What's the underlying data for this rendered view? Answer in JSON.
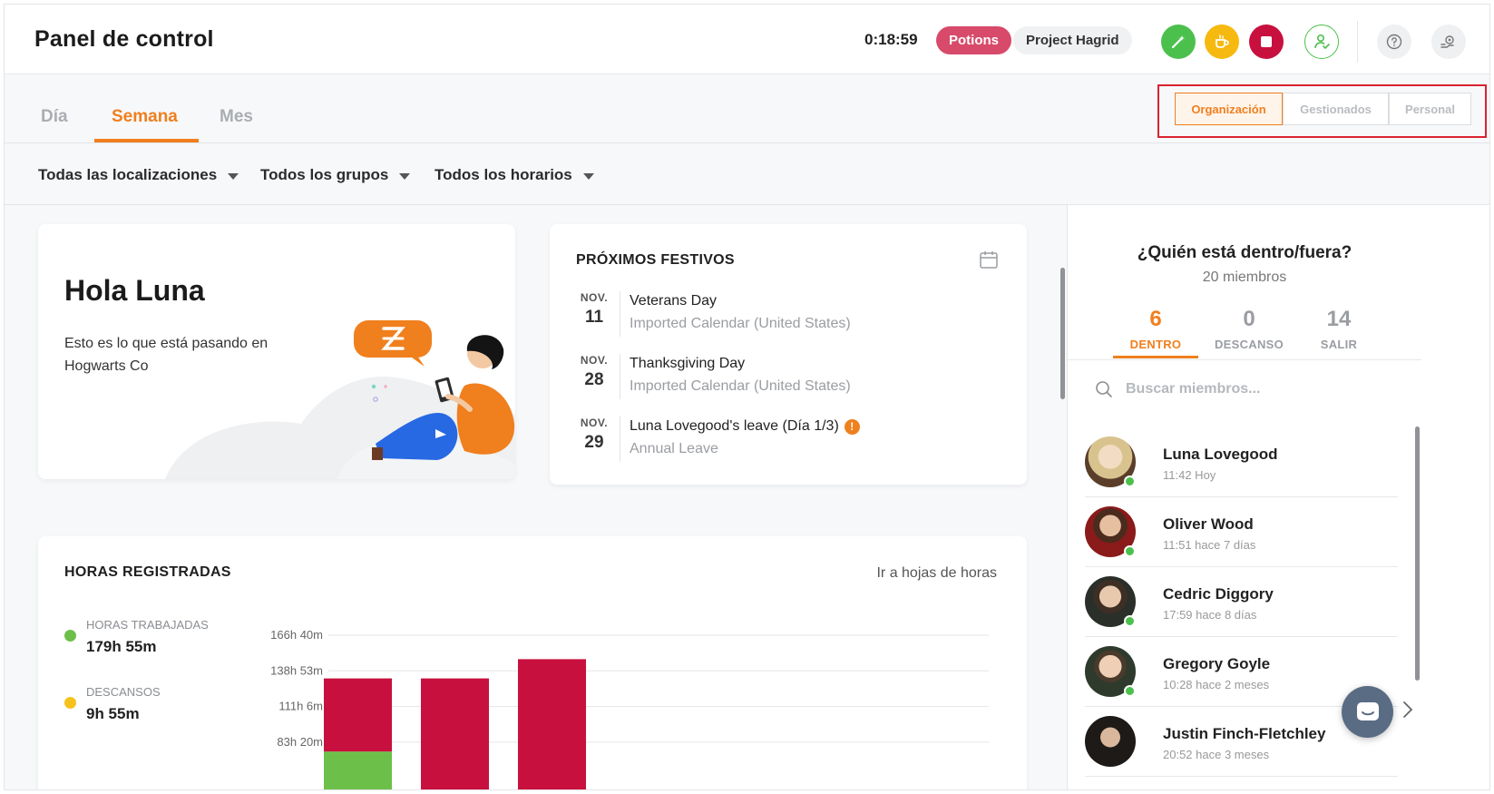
{
  "header": {
    "title": "Panel de control",
    "timer": "0:18:59",
    "activity_tag": "Potions",
    "project_tag": "Project Hagrid",
    "colors": {
      "accent": "#f07f1e",
      "green": "#4cc04c",
      "yellow": "#f6b90f",
      "red": "#c8103e",
      "potions": "#d84a6a"
    },
    "icons": [
      "wand-icon",
      "coffee-icon",
      "stop-icon",
      "user-check-icon",
      "help-icon",
      "settings-icon"
    ]
  },
  "tabs": [
    {
      "label": "Día",
      "active": false
    },
    {
      "label": "Semana",
      "active": true
    },
    {
      "label": "Mes",
      "active": false
    }
  ],
  "scope": [
    {
      "label": "Organización",
      "active": true
    },
    {
      "label": "Gestionados",
      "active": false
    },
    {
      "label": "Personal",
      "active": false
    }
  ],
  "filters": [
    "Todas las localizaciones",
    "Todos los grupos",
    "Todos los horarios"
  ],
  "greeting": {
    "title": "Hola Luna",
    "subtitle": "Esto es lo que está pasando en Hogwarts Co"
  },
  "holidays": {
    "title": "PRÓXIMOS FESTIVOS",
    "items": [
      {
        "month": "NOV.",
        "day": "11",
        "name": "Veterans Day",
        "source": "Imported Calendar (United States)"
      },
      {
        "month": "NOV.",
        "day": "28",
        "name": "Thanksgiving Day",
        "source": "Imported Calendar (United States)"
      },
      {
        "month": "NOV.",
        "day": "29",
        "name": "Luna Lovegood's leave (Día 1/3)",
        "source": "Annual Leave",
        "alert": "!"
      }
    ]
  },
  "hours": {
    "title": "HORAS REGISTRADAS",
    "link": "Ir a hojas de horas",
    "legend": [
      {
        "label": "HORAS TRABAJADAS",
        "value": "179h 55m",
        "color": "#6cc04a"
      },
      {
        "label": "DESCANSOS",
        "value": "9h 55m",
        "color": "#f6c21c"
      }
    ]
  },
  "chart_data": {
    "type": "bar",
    "stacked": true,
    "y_ticks": [
      "166h 40m",
      "138h 53m",
      "111h 6m",
      "83h 20m"
    ],
    "y_tick_values": [
      166.67,
      138.88,
      111.1,
      83.33
    ],
    "bars": [
      {
        "segments": [
          {
            "value": 76,
            "color": "#6cc04a"
          },
          {
            "value": 57,
            "color": "#c8103e"
          }
        ]
      },
      {
        "segments": [
          {
            "value": 133,
            "color": "#c8103e"
          }
        ]
      },
      {
        "segments": [
          {
            "value": 148,
            "color": "#c8103e"
          }
        ]
      }
    ],
    "grid": true
  },
  "who": {
    "title": "¿Quién está dentro/fuera?",
    "subtitle": "20 miembros",
    "stats": [
      {
        "num": "6",
        "label": "DENTRO",
        "active": true
      },
      {
        "num": "0",
        "label": "DESCANSO",
        "active": false
      },
      {
        "num": "14",
        "label": "SALIR",
        "active": false
      }
    ],
    "search_placeholder": "Buscar miembros...",
    "members": [
      {
        "name": "Luna Lovegood",
        "time": "11:42 Hoy",
        "avatar_color": "#c7b48a"
      },
      {
        "name": "Oliver Wood",
        "time": "11:51 hace 7 días",
        "avatar_color": "#6a3a2a"
      },
      {
        "name": "Cedric Diggory",
        "time": "17:59 hace 8 días",
        "avatar_color": "#4a4a3e"
      },
      {
        "name": "Gregory Goyle",
        "time": "10:28 hace 2 meses",
        "avatar_color": "#3d4a3a"
      },
      {
        "name": "Justin Finch-Fletchley",
        "time": "20:52 hace 3 meses",
        "avatar_color": "#2e2a26"
      }
    ]
  }
}
